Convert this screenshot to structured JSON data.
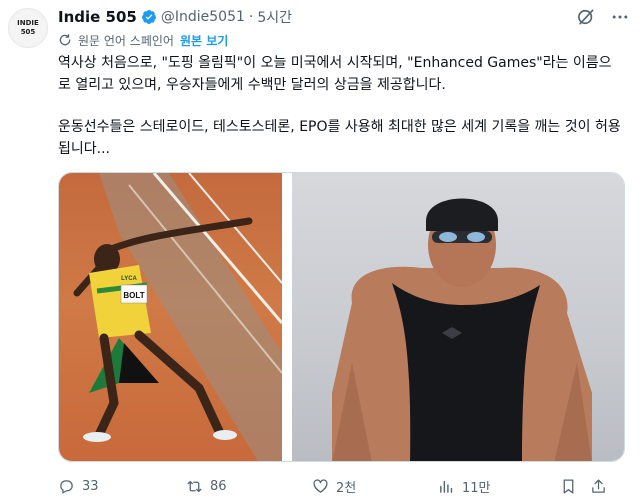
{
  "author": {
    "avatar_text_line1": "INDIE",
    "avatar_text_line2": "505",
    "name": "Indie 505",
    "handle": "@Indie5051",
    "separator": "·",
    "time": "5시간"
  },
  "translation": {
    "source_label": "원문 언어 스페인어",
    "show_original": "원본 보기"
  },
  "text": {
    "paragraph1": "역사상 처음으로, \"도핑 올림픽\"이 오늘 미국에서 시작되며, \"Enhanced Games\"라는 이름으로 열리고 있으며, 우승자들에게 수백만 달러의 상금을 제공합니다.",
    "paragraph2": "운동선수들은 스테로이드, 테스토스테론, EPO를 사용해 최대한 많은 세계 기록을 깨는 것이 허용됩니다..."
  },
  "media": {
    "image1_bib": "BOLT",
    "image1_sponsor": "LYCA"
  },
  "actions": {
    "replies": "33",
    "reposts": "86",
    "likes": "2천",
    "views": "11만"
  },
  "colors": {
    "accent": "#1d9bf0",
    "muted": "#536471",
    "text": "#0f1419"
  }
}
